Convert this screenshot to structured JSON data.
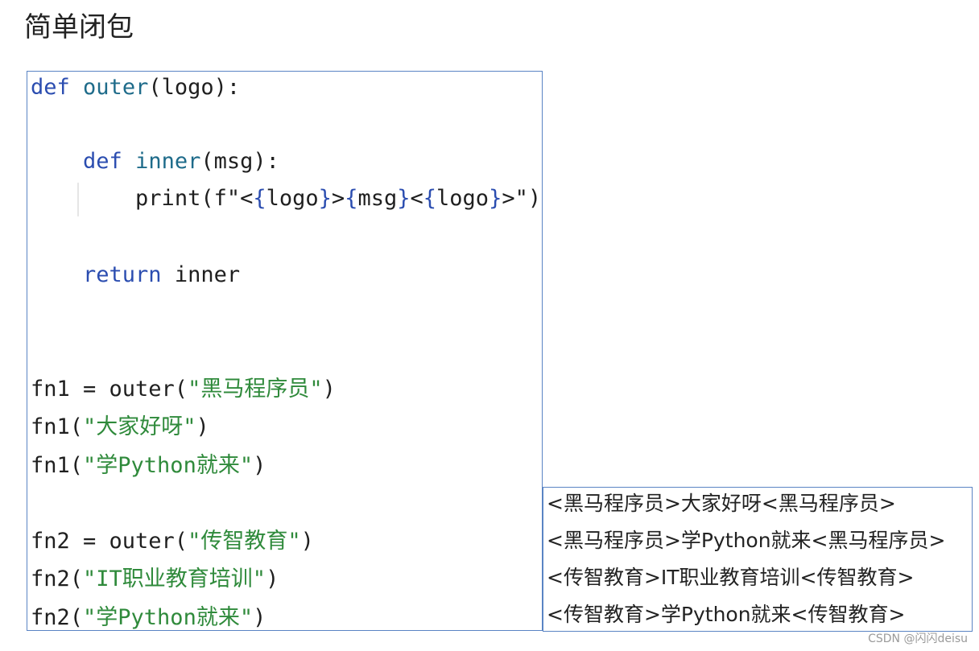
{
  "title": "简单闭包",
  "code": {
    "l1_kw": "def",
    "l1_name": "outer",
    "l1_rest": "(logo):",
    "l2_kw": "def",
    "l2_name": "inner",
    "l2_rest": "(msg):",
    "l3_a": "print(f\"<",
    "l3_b": "{",
    "l3_c": "logo",
    "l3_d": "}",
    "l3_e": ">",
    "l3_f": "{",
    "l3_g": "msg",
    "l3_h": "}",
    "l3_i": "<",
    "l3_j": "{",
    "l3_k": "logo",
    "l3_l": "}",
    "l3_m": ">\")",
    "l4_kw": "return",
    "l4_rest": " inner",
    "l5_a": "fn1 = outer(",
    "l5_s": "\"黑马程序员\"",
    "l5_b": ")",
    "l6_a": "fn1(",
    "l6_s": "\"大家好呀\"",
    "l6_b": ")",
    "l7_a": "fn1(",
    "l7_s": "\"学Python就来\"",
    "l7_b": ")",
    "l8_a": "fn2 = outer(",
    "l8_s": "\"传智教育\"",
    "l8_b": ")",
    "l9_a": "fn2(",
    "l9_s": "\"IT职业教育培训\"",
    "l9_b": ")",
    "l10_a": "fn2(",
    "l10_s": "\"学Python就来\"",
    "l10_b": ")"
  },
  "output": [
    "<黑马程序员>大家好呀<黑马程序员>",
    "<黑马程序员>学Python就来<黑马程序员>",
    "<传智教育>IT职业教育培训<传智教育>",
    "<传智教育>学Python就来<传智教育>"
  ],
  "watermark": "CSDN @闪闪deisu"
}
